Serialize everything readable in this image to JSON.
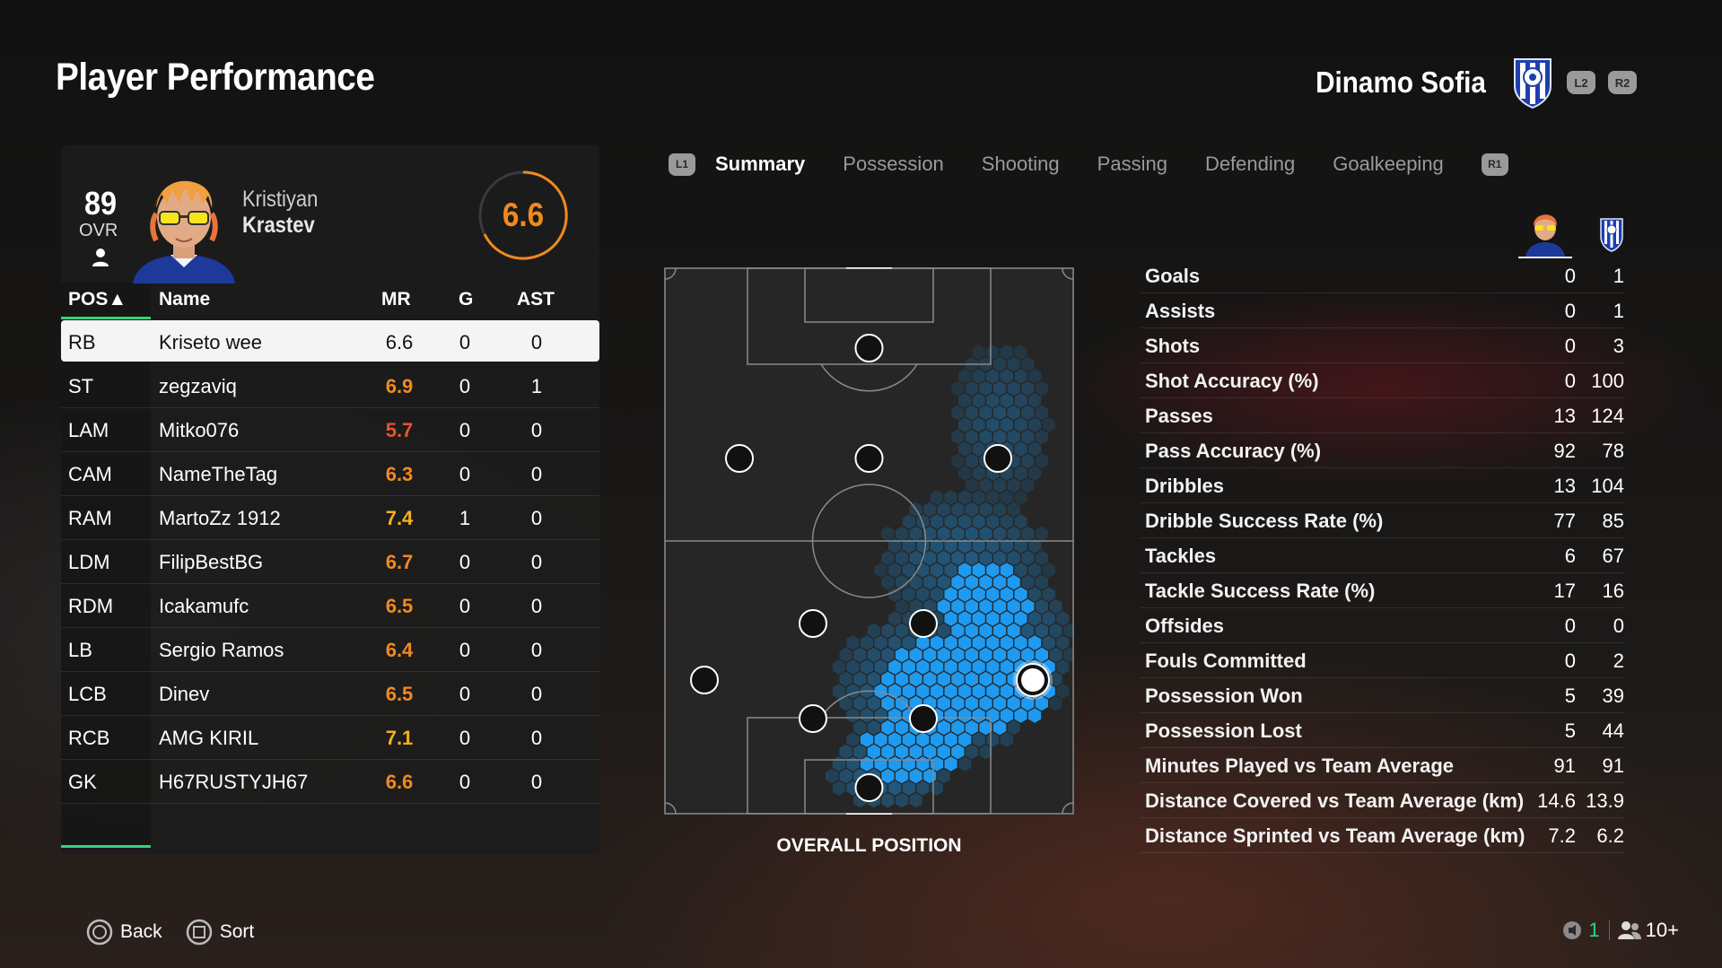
{
  "title": "Player Performance",
  "club": {
    "name": "Dinamo Sofia",
    "shoulder_buttons": [
      "L2",
      "R2"
    ],
    "crest_icon": "club-crest-icon"
  },
  "player": {
    "ovr": "89",
    "ovr_label": "OVR",
    "first_name": "Kristiyan",
    "last_name": "Krastev",
    "match_rating": "6.6",
    "rating_color": "#f08a1e"
  },
  "table": {
    "headers": {
      "pos": "POS▲",
      "name": "Name",
      "mr": "MR",
      "g": "G",
      "ast": "AST"
    },
    "rows": [
      {
        "pos": "RB",
        "name": "Kriseto wee",
        "mr": "6.6",
        "g": "0",
        "ast": "0",
        "mr_color": "#111111"
      },
      {
        "pos": "ST",
        "name": "zegzaviq",
        "mr": "6.9",
        "g": "0",
        "ast": "1",
        "mr_color": "#f08a1e"
      },
      {
        "pos": "LAM",
        "name": "Mitko076",
        "mr": "5.7",
        "g": "0",
        "ast": "0",
        "mr_color": "#e8542a"
      },
      {
        "pos": "CAM",
        "name": "NameTheTag",
        "mr": "6.3",
        "g": "0",
        "ast": "0",
        "mr_color": "#f08a1e"
      },
      {
        "pos": "RAM",
        "name": "MartoZz 1912",
        "mr": "7.4",
        "g": "1",
        "ast": "0",
        "mr_color": "#f2b21c"
      },
      {
        "pos": "LDM",
        "name": "FilipBestBG",
        "mr": "6.7",
        "g": "0",
        "ast": "0",
        "mr_color": "#f08a1e"
      },
      {
        "pos": "RDM",
        "name": "Icakamufc",
        "mr": "6.5",
        "g": "0",
        "ast": "0",
        "mr_color": "#f08a1e"
      },
      {
        "pos": "LB",
        "name": "Sergio Ramos",
        "mr": "6.4",
        "g": "0",
        "ast": "0",
        "mr_color": "#f08a1e"
      },
      {
        "pos": "LCB",
        "name": "Dinev",
        "mr": "6.5",
        "g": "0",
        "ast": "0",
        "mr_color": "#f08a1e"
      },
      {
        "pos": "RCB",
        "name": "AMG KIRIL",
        "mr": "7.1",
        "g": "0",
        "ast": "0",
        "mr_color": "#f2b21c"
      },
      {
        "pos": "GK",
        "name": "H67RUSTYJH67",
        "mr": "6.6",
        "g": "0",
        "ast": "0",
        "mr_color": "#f08a1e"
      }
    ],
    "selected_index": 0
  },
  "tabs": {
    "left_button": "L1",
    "right_button": "R1",
    "items": [
      "Summary",
      "Possession",
      "Shooting",
      "Passing",
      "Defending",
      "Goalkeeping"
    ],
    "active": "Summary"
  },
  "pitch": {
    "caption": "OVERALL POSITION",
    "heat_color": "#1e9af0"
  },
  "stats": [
    {
      "label": "Goals",
      "player": "0",
      "team": "1"
    },
    {
      "label": "Assists",
      "player": "0",
      "team": "1"
    },
    {
      "label": "Shots",
      "player": "0",
      "team": "3"
    },
    {
      "label": "Shot Accuracy (%)",
      "player": "0",
      "team": "100"
    },
    {
      "label": "Passes",
      "player": "13",
      "team": "124"
    },
    {
      "label": "Pass Accuracy (%)",
      "player": "92",
      "team": "78"
    },
    {
      "label": "Dribbles",
      "player": "13",
      "team": "104"
    },
    {
      "label": "Dribble Success Rate (%)",
      "player": "77",
      "team": "85"
    },
    {
      "label": "Tackles",
      "player": "6",
      "team": "67"
    },
    {
      "label": "Tackle Success Rate (%)",
      "player": "17",
      "team": "16"
    },
    {
      "label": "Offsides",
      "player": "0",
      "team": "0"
    },
    {
      "label": "Fouls Committed",
      "player": "0",
      "team": "2"
    },
    {
      "label": "Possession Won",
      "player": "5",
      "team": "39"
    },
    {
      "label": "Possession Lost",
      "player": "5",
      "team": "44"
    },
    {
      "label": "Minutes Played vs Team Average",
      "player": "91",
      "team": "91"
    },
    {
      "label": "Distance Covered vs Team Average (km)",
      "player": "14.6",
      "team": "13.9"
    },
    {
      "label": "Distance Sprinted vs Team Average (km)",
      "player": "7.2",
      "team": "6.2"
    }
  ],
  "footer": {
    "back_label": "Back",
    "sort_label": "Sort",
    "notifications_count": "1",
    "players_count": "10+"
  }
}
